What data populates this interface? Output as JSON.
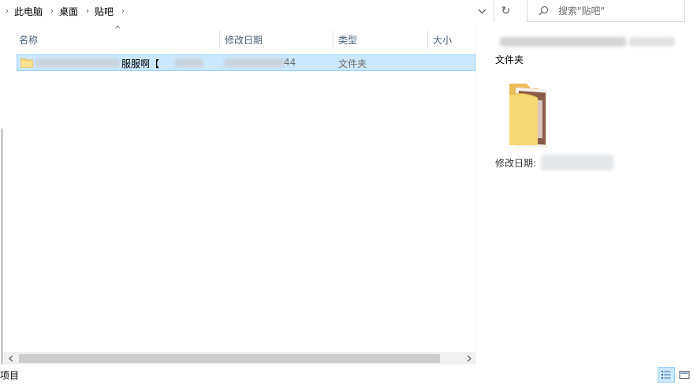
{
  "address": {
    "breadcrumbs": [
      "此电脑",
      "桌面",
      "贴吧"
    ],
    "separator_glyph": "›",
    "dropdown_glyph": "⌄",
    "refresh_glyph": "↻"
  },
  "search": {
    "placeholder": "搜索\"贴吧\"",
    "icon": "search-icon"
  },
  "list": {
    "columns": [
      "名称",
      "修改日期",
      "类型",
      "大小"
    ],
    "sort_indicator": "^",
    "rows": [
      {
        "name": "服服啊【",
        "date": "44",
        "type": "文件夹",
        "icon": "folder-icon"
      }
    ]
  },
  "preview": {
    "type": "文件夹",
    "modified_label": "修改日期:"
  },
  "status": {
    "item_count": "项目"
  },
  "colors": {
    "selection_bg": "#cce8ff",
    "selection_border": "#99d1ff",
    "header_text": "#4c607a",
    "folder_yellow": "#f8d775"
  }
}
